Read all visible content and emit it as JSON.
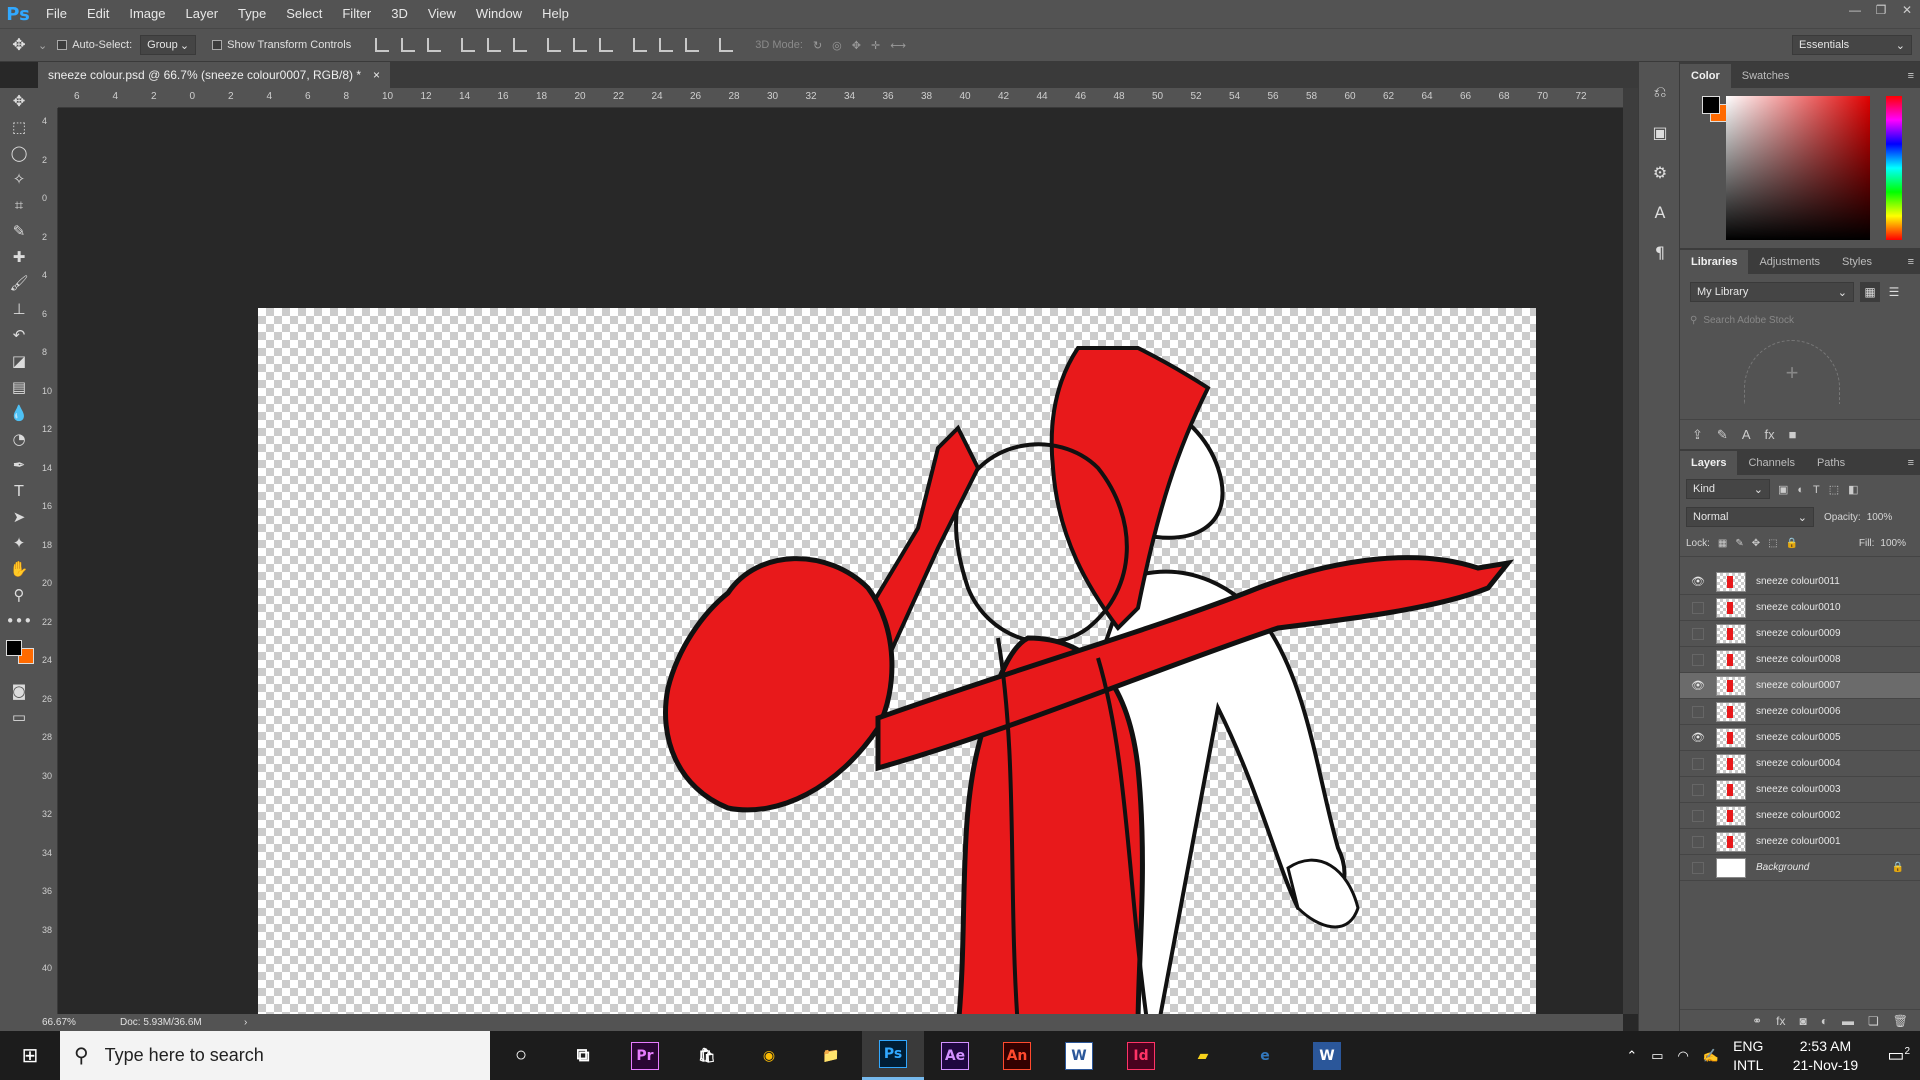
{
  "menubar": {
    "app_logo": "Ps",
    "items": [
      "File",
      "Edit",
      "Image",
      "Layer",
      "Type",
      "Select",
      "Filter",
      "3D",
      "View",
      "Window",
      "Help"
    ]
  },
  "options": {
    "auto_select_label": "Auto-Select:",
    "auto_select_value": "Group",
    "show_transform_label": "Show Transform Controls",
    "mode3d_label": "3D Mode:",
    "workspace": "Essentials"
  },
  "document": {
    "tab_title": "sneeze colour.psd @ 66.7% (sneeze colour0007, RGB/8) *",
    "close": "×"
  },
  "ruler_h": [
    "6",
    "4",
    "2",
    "0",
    "2",
    "4",
    "6",
    "8",
    "10",
    "12",
    "14",
    "16",
    "18",
    "20",
    "22",
    "24",
    "26",
    "28",
    "30",
    "32",
    "34",
    "36",
    "38",
    "40",
    "42",
    "44",
    "46",
    "48",
    "50",
    "52",
    "54",
    "56",
    "58",
    "60",
    "62",
    "64",
    "66",
    "68",
    "70",
    "72"
  ],
  "ruler_v": [
    "4",
    "2",
    "0",
    "2",
    "4",
    "6",
    "8",
    "10",
    "12",
    "14",
    "16",
    "18",
    "20",
    "22",
    "24",
    "26",
    "28",
    "30",
    "32",
    "34",
    "36",
    "38",
    "40"
  ],
  "status": {
    "zoom": "66.67%",
    "doc_size": "Doc: 5.93M/36.6M"
  },
  "color_panel": {
    "tabs": [
      "Color",
      "Swatches"
    ],
    "fg_color": "#000000",
    "bg_color": "#ff6a00"
  },
  "libraries_panel": {
    "tabs": [
      "Libraries",
      "Adjustments",
      "Styles"
    ],
    "library": "My Library",
    "search_placeholder": "Search Adobe Stock"
  },
  "layers_panel": {
    "tabs": [
      "Layers",
      "Channels",
      "Paths"
    ],
    "filter": "Kind",
    "blend_mode": "Normal",
    "opacity_label": "Opacity:",
    "opacity": "100%",
    "lock_label": "Lock:",
    "fill_label": "Fill:",
    "fill": "100%",
    "layers": [
      {
        "name": "sneeze colour0011",
        "visible": true,
        "selected": false
      },
      {
        "name": "sneeze colour0010",
        "visible": false,
        "selected": false
      },
      {
        "name": "sneeze colour0009",
        "visible": false,
        "selected": false
      },
      {
        "name": "sneeze colour0008",
        "visible": false,
        "selected": false
      },
      {
        "name": "sneeze colour0007",
        "visible": true,
        "selected": true
      },
      {
        "name": "sneeze colour0006",
        "visible": false,
        "selected": false
      },
      {
        "name": "sneeze colour0005",
        "visible": true,
        "selected": false
      },
      {
        "name": "sneeze colour0004",
        "visible": false,
        "selected": false
      },
      {
        "name": "sneeze colour0003",
        "visible": false,
        "selected": false
      },
      {
        "name": "sneeze colour0002",
        "visible": false,
        "selected": false
      },
      {
        "name": "sneeze colour0001",
        "visible": false,
        "selected": false
      },
      {
        "name": "Background",
        "visible": false,
        "selected": false
      }
    ]
  },
  "taskbar": {
    "search_placeholder": "Type here to search",
    "apps": [
      "Pr",
      "Store",
      "Chrome",
      "Explorer",
      "Ps",
      "Ae",
      "An",
      "W",
      "Id",
      "Notes",
      "Edge",
      "Word"
    ],
    "lang_top": "ENG",
    "lang_bottom": "INTL",
    "time": "2:53 AM",
    "date": "21-Nov-19",
    "notif_count": "2"
  }
}
